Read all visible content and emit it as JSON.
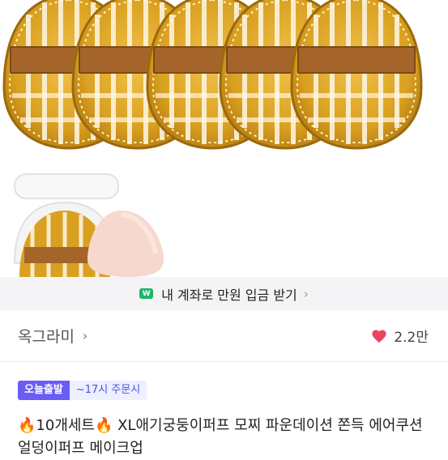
{
  "banner": {
    "text": "내 계좌로 만원 입금 받기",
    "icon": "won-icon",
    "chevron": "›"
  },
  "seller": {
    "name": "옥그라미",
    "chevron": "›"
  },
  "likes": {
    "count": "2.2만",
    "icon": "heart-icon",
    "color": "#e94560"
  },
  "badges": {
    "primary": "오늘출발",
    "secondary": "~17시 주문시"
  },
  "product": {
    "title": "🔥10개세트🔥 XL애기궁둥이퍼프 모찌 파운데이션 쫀득 에어쿠션 얼덩이퍼프 메이크업"
  },
  "colors": {
    "puff_gold": "#d9a021",
    "ribbon_brown": "#a5652a",
    "accent_purple": "#6b5cf5",
    "heart_red": "#e94560",
    "banner_bg": "#f4f4f6"
  }
}
